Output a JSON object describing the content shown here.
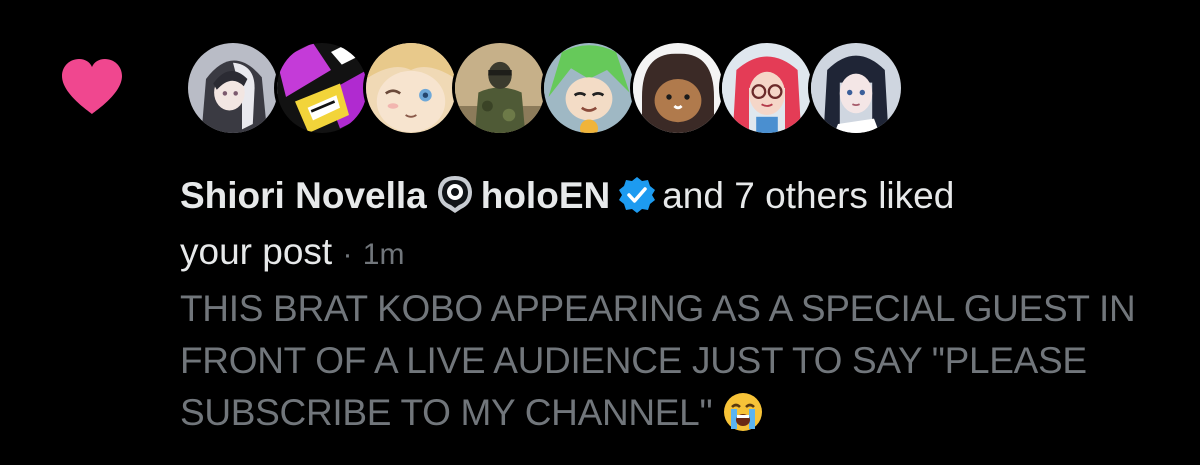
{
  "colors": {
    "background": "#000000",
    "heart": "#f0478f",
    "primary_text": "#e7e9ea",
    "secondary_text": "#71767b",
    "verified": "#1d9bf0"
  },
  "notification": {
    "icon": "heart-icon",
    "avatars": [
      {
        "label": "avatar-1"
      },
      {
        "label": "avatar-2"
      },
      {
        "label": "avatar-3"
      },
      {
        "label": "avatar-4"
      },
      {
        "label": "avatar-5"
      },
      {
        "label": "avatar-6"
      },
      {
        "label": "avatar-7"
      },
      {
        "label": "avatar-8"
      }
    ],
    "user1_name": "Shiori Novella",
    "user1_badge_icon": "eye-badge-icon",
    "user2_name": "holoEN",
    "user2_badge_icon": "verified-badge-icon",
    "others_text": "and 7 others liked",
    "your_post_text": "your post",
    "separator": "·",
    "timestamp": "1m",
    "post_text": "THIS BRAT KOBO APPEARING AS A SPECIAL GUEST IN FRONT OF A LIVE AUDIENCE JUST TO SAY \"PLEASE SUBSCRIBE TO MY CHANNEL\"",
    "emoji_icon": "crying-face-emoji"
  }
}
